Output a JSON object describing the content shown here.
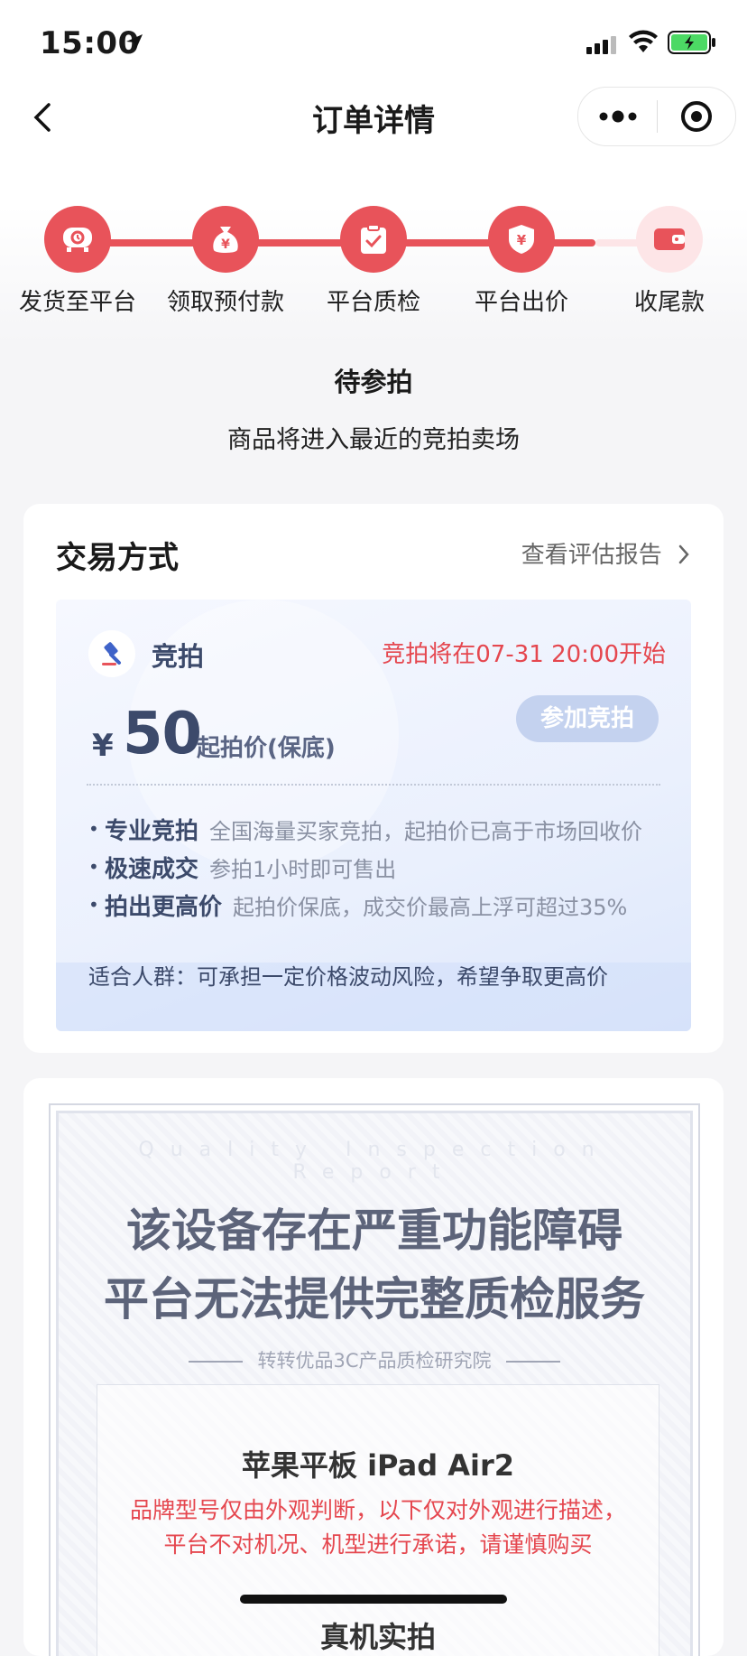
{
  "status_bar": {
    "time": "15:00"
  },
  "nav": {
    "title": "订单详情"
  },
  "steps": [
    {
      "label": "发货至平台",
      "icon": "delivery-icon"
    },
    {
      "label": "领取预付款",
      "icon": "money-bag-icon"
    },
    {
      "label": "平台质检",
      "icon": "clipboard-check-icon"
    },
    {
      "label": "平台出价",
      "icon": "shield-yen-icon"
    },
    {
      "label": "收尾款",
      "icon": "wallet-icon"
    }
  ],
  "order_status": {
    "title": "待参拍",
    "description": "商品将进入最近的竞拍卖场"
  },
  "trade": {
    "title": "交易方式",
    "report_link": "查看评估报告",
    "method_name": "竞拍",
    "start_text": "竞拍将在07-31 20:00开始",
    "currency": "¥",
    "price": "50",
    "price_label": "起拍价(保底)",
    "join_button": "参加竞拍",
    "features": [
      {
        "name": "专业竞拍",
        "desc": "全国海量买家竞拍，起拍价已高于市场回收价"
      },
      {
        "name": "极速成交",
        "desc": "参拍1小时即可售出"
      },
      {
        "name": "拍出更高价",
        "desc": "起拍价保底，成交价最高上浮可超过35%"
      }
    ],
    "suitable": "适合人群：可承担一定价格波动风险，希望争取更高价"
  },
  "certificate": {
    "watermark": "Quality Inspection Report",
    "headline_1": "该设备存在严重功能障碍",
    "headline_2": "平台无法提供完整质检服务",
    "institute": "转转优品3C产品质检研究院",
    "model": "苹果平板 iPad Air2",
    "warning": "品牌型号仅由外观判断，以下仅对外观进行描述，平台不对机况、机型进行承诺，请谨慎购买",
    "section": "真机实拍"
  },
  "colors": {
    "accent": "#e8535a",
    "auction_text": "#3c4a6b",
    "alert": "#e5474f"
  }
}
